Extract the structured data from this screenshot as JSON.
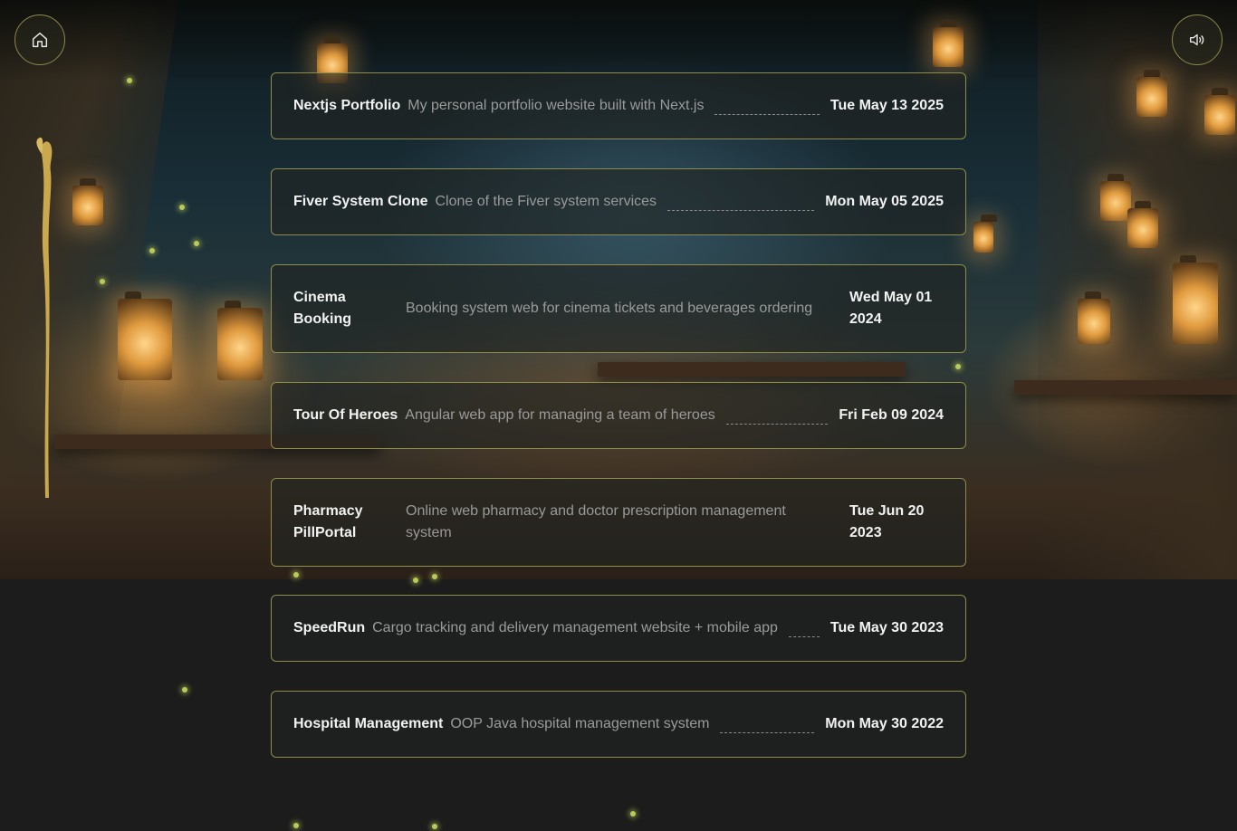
{
  "nav": {
    "home_icon": "home-icon",
    "sound_icon": "speaker-icon"
  },
  "projects": [
    {
      "name": "Nextjs Portfolio",
      "description": "My personal portfolio website built with Next.js",
      "date": "Tue May 13 2025"
    },
    {
      "name": "Fiver System Clone",
      "description": "Clone of the Fiver system services",
      "date": "Mon May 05 2025"
    },
    {
      "name": "Cinema Booking",
      "description": "Booking system web for cinema tickets and beverages ordering",
      "date": "Wed May 01 2024"
    },
    {
      "name": "Tour Of Heroes",
      "description": "Angular web app for managing a team of heroes",
      "date": "Fri Feb 09 2024"
    },
    {
      "name": "Pharmacy PillPortal",
      "description": "Online web pharmacy and doctor prescription management system",
      "date": "Tue Jun 20 2023"
    },
    {
      "name": "SpeedRun",
      "description": "Cargo tracking and delivery management website + mobile app",
      "date": "Tue May 30 2023"
    },
    {
      "name": "Hospital Management",
      "description": "OOP Java hospital management system",
      "date": "Mon May 30 2022"
    }
  ],
  "colors": {
    "card_border": "#8e8e48",
    "page_background": "#1c1c1c",
    "firefly": "#b9c95a"
  }
}
